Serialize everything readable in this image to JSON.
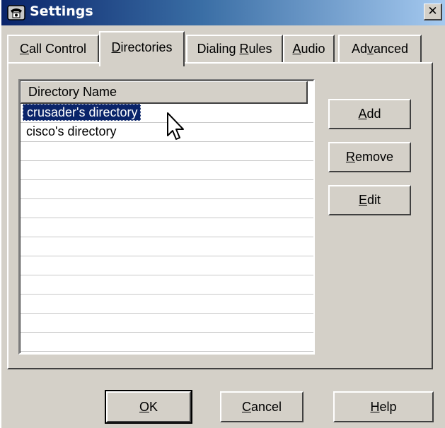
{
  "window": {
    "title": "Settings",
    "icon": "telephone-icon",
    "close_glyph": "✕"
  },
  "tabs": [
    {
      "label_pre": "",
      "label_u": "C",
      "label_post": "all Control",
      "active": false
    },
    {
      "label_pre": "",
      "label_u": "D",
      "label_post": "irectories",
      "active": true
    },
    {
      "label_pre": "Dialing ",
      "label_u": "R",
      "label_post": "ules",
      "active": false
    },
    {
      "label_pre": "",
      "label_u": "A",
      "label_post": "udio",
      "active": false
    },
    {
      "label_pre": "Ad",
      "label_u": "v",
      "label_post": "anced",
      "active": false
    }
  ],
  "directories": {
    "column_header": "Directory Name",
    "rows": [
      "crusader's directory",
      "cisco's directory"
    ],
    "selected_index": 0
  },
  "side_buttons": {
    "add": {
      "u": "A",
      "post": "dd"
    },
    "remove": {
      "u": "R",
      "post": "emove"
    },
    "edit": {
      "u": "E",
      "post": "dit"
    }
  },
  "bottom_buttons": {
    "ok": {
      "u": "O",
      "post": "K"
    },
    "cancel": {
      "u": "C",
      "post": "ancel"
    },
    "help": {
      "u": "H",
      "post": "elp"
    }
  }
}
